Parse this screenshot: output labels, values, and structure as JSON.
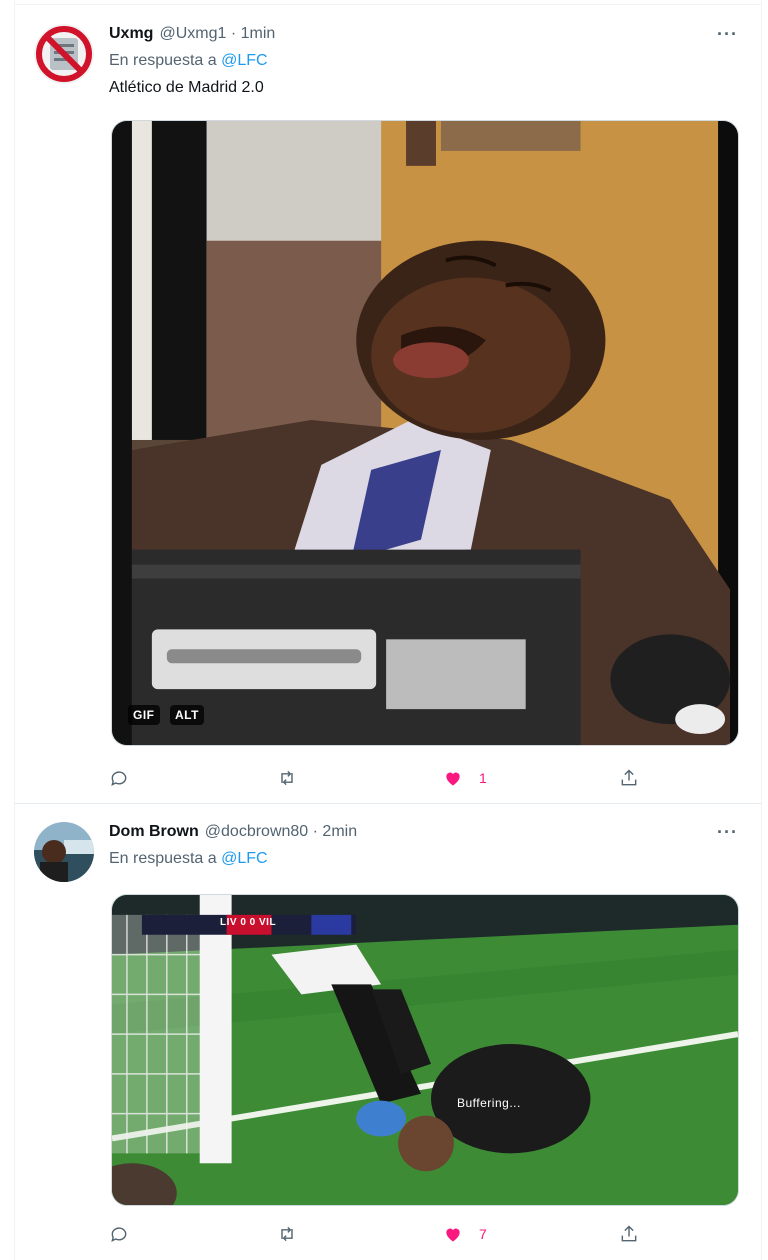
{
  "tweets": [
    {
      "name": "Uxmg",
      "handle": "@Uxmg1 · 1min",
      "reply_prefix": "En respuesta a",
      "reply_to": "@LFC",
      "text": "Atlético de Madrid 2.0",
      "media": {
        "badge_gif": "GIF",
        "badge_alt": "ALT",
        "description": "man asleep in office chair"
      },
      "actions": {
        "reply_count": "",
        "retweet_count": "",
        "like_count": "1",
        "liked": true
      }
    },
    {
      "name": "Dom Brown",
      "handle": "@docbrown80 · 2min",
      "reply_prefix": "En respuesta a",
      "reply_to": "@LFC",
      "text": "",
      "media": {
        "scoreboard": "LIV 0 0 VIL",
        "overlay_text": "Buffering..."
      },
      "actions": {
        "reply_count": "",
        "retweet_count": "",
        "like_count": "7",
        "liked": true
      }
    }
  ],
  "more_label": "···",
  "colors": {
    "accent": "#1d9bf0",
    "like": "#f91880",
    "muted": "#536471"
  }
}
